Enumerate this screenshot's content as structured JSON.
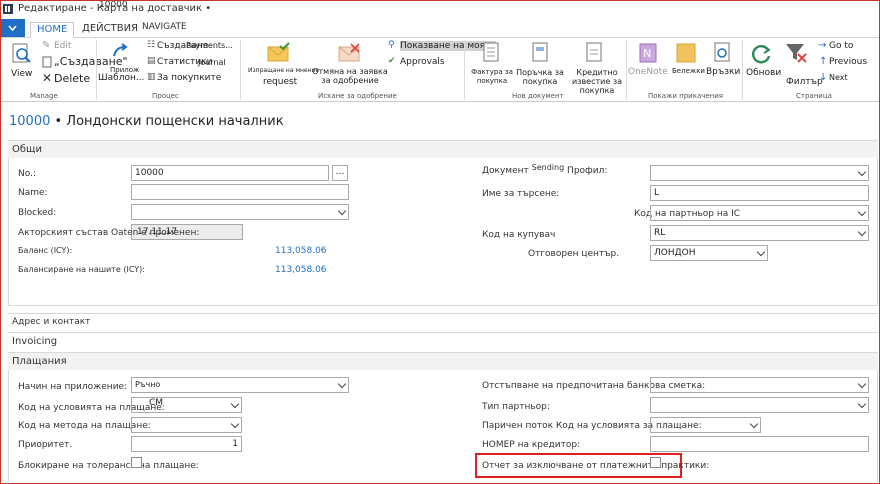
{
  "window": {
    "title": "Редактиране - Карта на доставчик •",
    "overlay_id": "10000"
  },
  "tabs": {
    "home": "HOME",
    "actions": "ДЕЙСТВИЯ",
    "navigate": "NAVIGATE"
  },
  "ribbon": {
    "view": "View",
    "edit": "Edit",
    "create": "„Създаване\"",
    "delete": "Delete",
    "templates": "Шаблон...",
    "applied": "Прилож",
    "payments": "Payments...",
    "create2": "Създаване",
    "statistics": "Статистики",
    "journal": "Journal",
    "for_purchases": "За покупките",
    "send_approval": "Изпращане на мнение",
    "request": "request",
    "cancel_approval": "Отмяна на заявка за одобрение",
    "show_mine": "Показване на моята",
    "approvals": "Approvals",
    "invoice": "Фактура за покупка",
    "order": "Поръчка за покупка",
    "credit_memo": "Кредитно известие за покупка",
    "onenote": "OneNote",
    "notes": "Бележки",
    "links": "Връзки",
    "refresh": "Обнови",
    "filter": "Филтър",
    "goto": "Go to",
    "previous": "Previous",
    "next": "Next",
    "groups": {
      "manage": "Manage",
      "process": "Процес",
      "approval": "Искане за одобрение",
      "new_doc": "Нов документ",
      "attachments": "Покажи прикачения",
      "page": "Страница"
    }
  },
  "page": {
    "title_no": "10000",
    "title_sep": " • ",
    "title_name": "Лондонски пощенски началник"
  },
  "sections": {
    "general": "Общи",
    "address": "Адрес и контакт",
    "invoicing": "Invoicing",
    "payments": "Плащания"
  },
  "general": {
    "no_label": "No.:",
    "no_value": "10000",
    "name_label": "Name:",
    "name_value": "",
    "blocked_label": "Blocked:",
    "blocked_value": "",
    "last_date_label": "Акторският състав Oaten е променен:",
    "last_date_value": "17.11.17",
    "balance_label": "Баланс (ICY):",
    "balance_value": "113,058.06",
    "balance_due_label": "Балансиране на нашите (ICY):",
    "balance_due_value": "113,058.06",
    "doc_sending_label": "Документ",
    "doc_sending_label2": "Sending",
    "doc_sending_label3": "Профил:",
    "doc_sending_value": "",
    "search_name_label": "Име за търсене:",
    "search_name_value": "L",
    "ic_partner_label": "Код на партньор на IC",
    "ic_partner_value": "",
    "purchaser_label": "Код на купувач",
    "purchaser_value": "RL",
    "resp_center_label": "Отговорен център.",
    "resp_center_value": "ЛОНДОН"
  },
  "payments": {
    "application_label": "Начин на приложение:",
    "application_value": "Ръчно",
    "terms_label": "Код на условията на плащане:",
    "terms_value": "CM",
    "method_label": "Код на метода на плащане:",
    "method_value": "",
    "priority_label": "Приоритет.",
    "priority_value": "1",
    "block_tol_label": "Блокиране на толеранса на плащане:",
    "preferred_bank_label": "Отстъпване на предпочитана банкова сметка:",
    "preferred_bank_value": "",
    "partner_type_label": "Тип партньор:",
    "partner_type_value": "",
    "cash_flow_label": "Паричен поток Код на условията за плащане:",
    "cash_flow_value": "",
    "creditor_no_label": "НОМЕР на кредитор:",
    "creditor_no_value": "",
    "exclude_label": "Отчет за изключване от платежните практики:"
  },
  "colors": {
    "accent": "#1f6fc5",
    "highlight": "#e02020",
    "section_bg": "#f2f2f2"
  }
}
